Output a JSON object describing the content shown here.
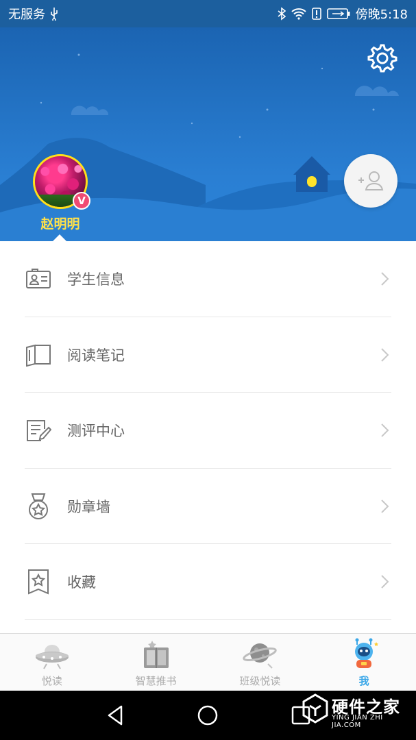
{
  "status_bar": {
    "carrier": "无服务",
    "time": "傍晚5:18",
    "icons": [
      "usb-icon",
      "bluetooth-icon",
      "wifi-icon",
      "alert-icon",
      "battery-icon"
    ]
  },
  "profile": {
    "username": "赵明明",
    "vip_badge": "V"
  },
  "menu": {
    "items": [
      {
        "label": "学生信息",
        "icon": "id-card-icon"
      },
      {
        "label": "阅读笔记",
        "icon": "book-icon"
      },
      {
        "label": "测评中心",
        "icon": "edit-note-icon"
      },
      {
        "label": "勋章墙",
        "icon": "medal-icon"
      },
      {
        "label": "收藏",
        "icon": "bookmark-star-icon"
      }
    ]
  },
  "tab_bar": {
    "tabs": [
      {
        "label": "悦读",
        "icon": "ufo-icon",
        "active": false
      },
      {
        "label": "智慧推书",
        "icon": "books-icon",
        "active": false
      },
      {
        "label": "班级悦读",
        "icon": "planet-icon",
        "active": false
      },
      {
        "label": "我",
        "icon": "astronaut-icon",
        "active": true
      }
    ]
  },
  "watermark": {
    "title": "硬件之家",
    "subtitle": "YING JIAN ZHI JIA.COM"
  },
  "colors": {
    "header_blue": "#1b64b2",
    "username_yellow": "#ffe14a",
    "active_tab": "#3aa7e8",
    "vip_badge": "#ef4b73"
  }
}
